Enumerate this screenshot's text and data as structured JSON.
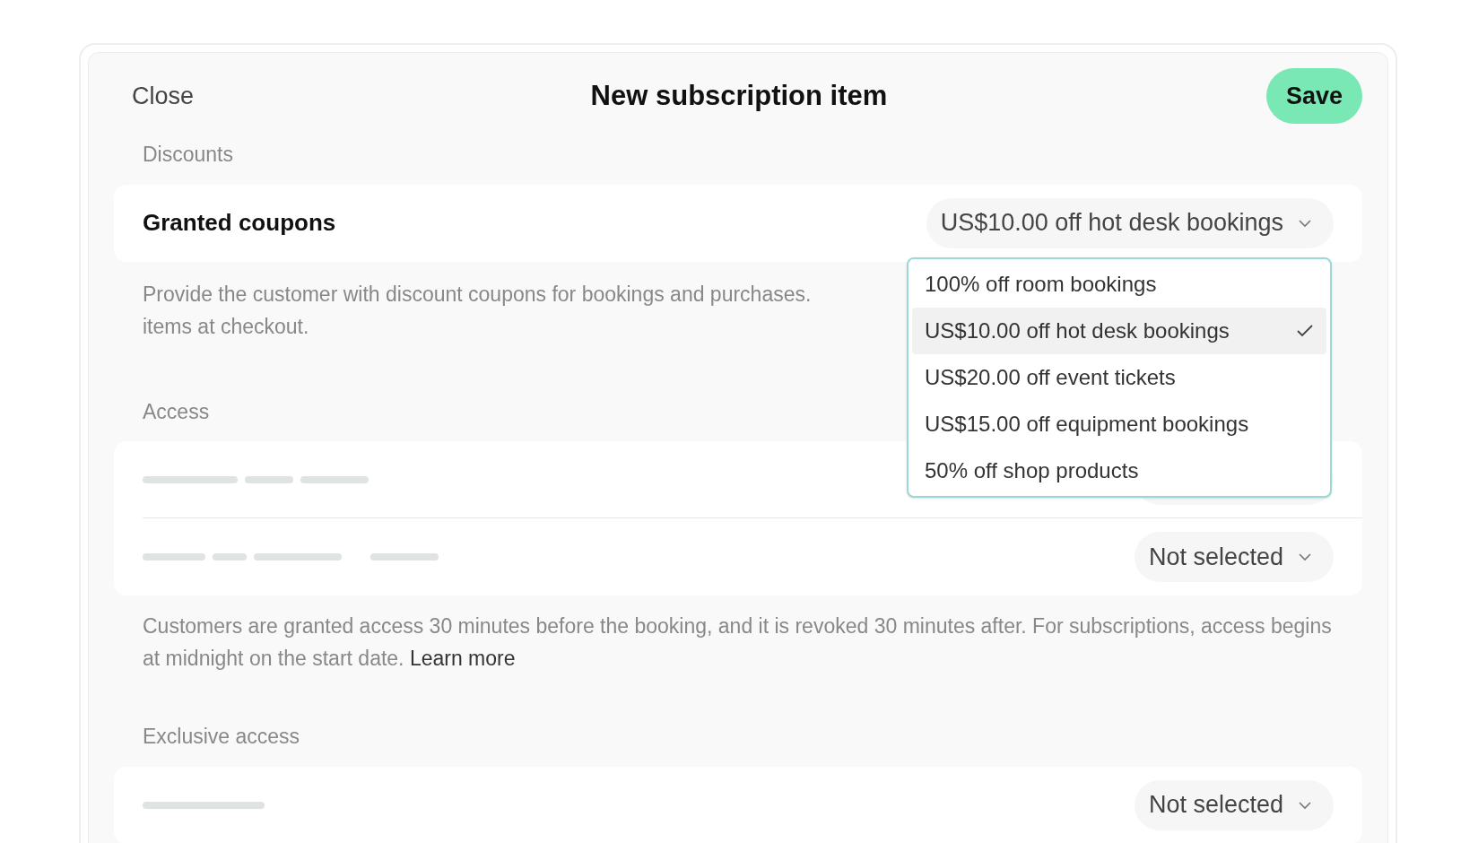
{
  "header": {
    "close": "Close",
    "title": "New subscription item",
    "save": "Save"
  },
  "discounts": {
    "heading": "Discounts",
    "label": "Granted coupons",
    "value": "US$10.00 off hot desk bookings",
    "options": [
      {
        "label": "100% off room bookings",
        "selected": false
      },
      {
        "label": "US$10.00 off hot desk bookings",
        "selected": true
      },
      {
        "label": "US$20.00 off event tickets",
        "selected": false
      },
      {
        "label": "US$15.00 off equipment bookings",
        "selected": false
      },
      {
        "label": "50% off shop products",
        "selected": false
      }
    ],
    "description_lines": [
      "Provide the customer with discount coupons for bookings and purchases.",
      "items at checkout."
    ]
  },
  "access": {
    "heading": "Access",
    "second_value": "Not selected",
    "description": "Customers are granted access 30 minutes before the booking, and it is revoked 30 minutes after. For subscriptions, access begins at midnight on the start date.",
    "link": "Learn more"
  },
  "exclusive_access": {
    "heading": "Exclusive access",
    "value": "Not selected"
  }
}
